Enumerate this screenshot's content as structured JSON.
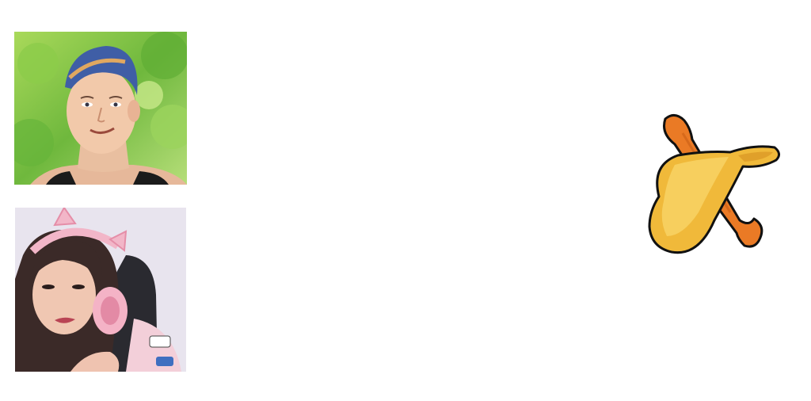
{
  "images": [
    {
      "name": "photo-man",
      "description_icon": "cartoon-man-portrait-icon"
    },
    {
      "name": "photo-woman",
      "description_icon": "cartoon-woman-headphones-portrait-icon"
    }
  ],
  "logo": {
    "icon": "potato-chip-and-stick-snack-icon"
  },
  "colors": {
    "background": "#ffffff",
    "foliage_green": "#7cc242",
    "hair_blue": "#3a5a9a",
    "skin": "#f1c9a8",
    "pink": "#f2b6c8",
    "chip_yellow": "#f0b93a",
    "stick_orange": "#ea7a25",
    "outline": "#111111"
  }
}
